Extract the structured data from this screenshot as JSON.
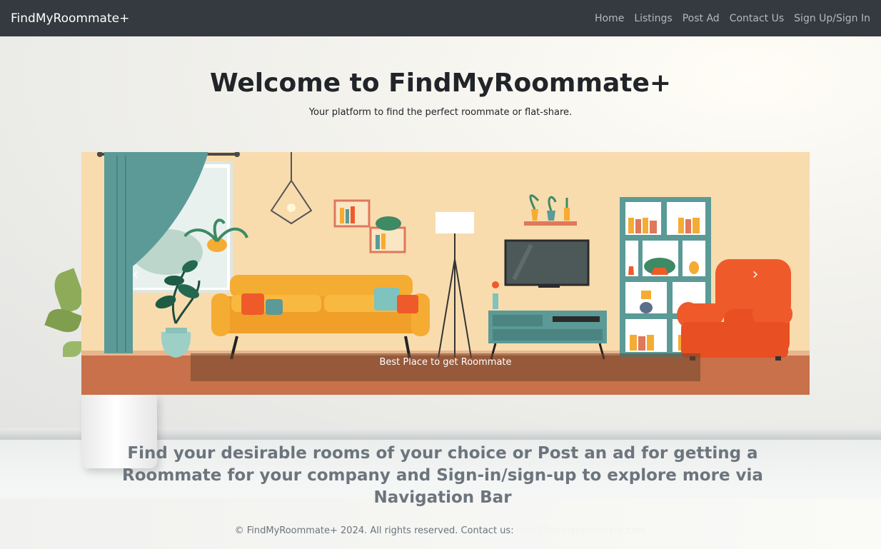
{
  "navbar": {
    "brand": "FindMyRoommate+",
    "links": [
      {
        "label": "Home"
      },
      {
        "label": "Listings"
      },
      {
        "label": "Post Ad"
      },
      {
        "label": "Contact Us"
      },
      {
        "label": "Sign Up/Sign In"
      }
    ]
  },
  "hero": {
    "title": "Welcome to FindMyRoommate+",
    "subtitle": "Your platform to find the perfect roommate or flat-share."
  },
  "carousel": {
    "caption": "Best Place to get Roommate",
    "prev_icon": "chevron-left-icon",
    "next_icon": "chevron-right-icon"
  },
  "promo": {
    "text": "Find your desirable rooms of your choice or Post an ad for getting a Roommate for your company and Sign-in/sign-up to explore more via Navigation Bar"
  },
  "footer": {
    "text": "© FindMyRoommate+ 2024. All rights reserved. Contact us:",
    "email": "info@findmyroommate.com"
  },
  "colors": {
    "navbar_bg": "#343a40",
    "nav_link": "#b4b8bc",
    "title": "#212529",
    "muted": "#6c757d",
    "sofa": "#f5ac32",
    "armchair": "#ef5a2b",
    "teal": "#5b9a96",
    "wall": "#f8dcae",
    "floor": "#c8714a"
  }
}
